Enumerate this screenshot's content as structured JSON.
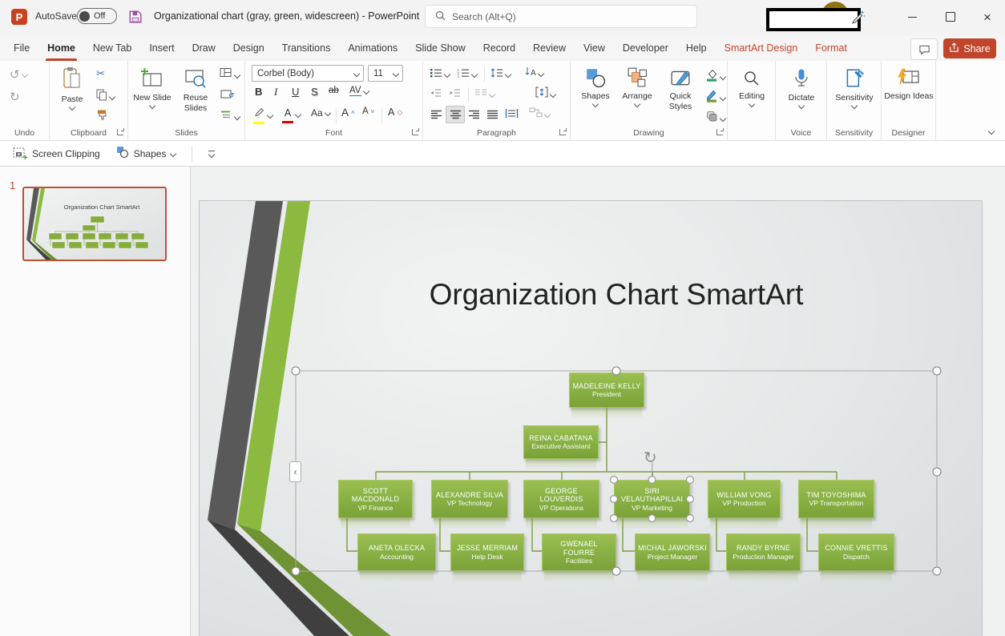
{
  "titlebar": {
    "autosave_label": "AutoSave",
    "autosave_state": "Off",
    "document_title": "Organizational chart (gray, green, widescreen)  -  PowerPoint",
    "search_placeholder": "Search (Alt+Q)"
  },
  "tabs": {
    "active_tab": "Home",
    "items": [
      {
        "label": "File",
        "contextual": false
      },
      {
        "label": "Home",
        "contextual": false
      },
      {
        "label": "New Tab",
        "contextual": false
      },
      {
        "label": "Insert",
        "contextual": false
      },
      {
        "label": "Draw",
        "contextual": false
      },
      {
        "label": "Design",
        "contextual": false
      },
      {
        "label": "Transitions",
        "contextual": false
      },
      {
        "label": "Animations",
        "contextual": false
      },
      {
        "label": "Slide Show",
        "contextual": false
      },
      {
        "label": "Record",
        "contextual": false
      },
      {
        "label": "Review",
        "contextual": false
      },
      {
        "label": "View",
        "contextual": false
      },
      {
        "label": "Developer",
        "contextual": false
      },
      {
        "label": "Help",
        "contextual": false
      },
      {
        "label": "SmartArt Design",
        "contextual": true
      },
      {
        "label": "Format",
        "contextual": true
      }
    ],
    "share_label": "Share"
  },
  "ribbon": {
    "undo": {
      "group_label": "Undo"
    },
    "clipboard": {
      "group_label": "Clipboard",
      "paste_label": "Paste"
    },
    "slides": {
      "group_label": "Slides",
      "new_slide_label": "New Slide",
      "reuse_slides_label": "Reuse Slides"
    },
    "font": {
      "group_label": "Font",
      "font_name": "Corbel (Body)",
      "font_size": "11",
      "bold": "B",
      "italic": "I",
      "underline": "U",
      "shadow": "S",
      "strikethrough": "ab",
      "char_spacing": "AV",
      "change_case": "Aa",
      "grow": "A",
      "shrink": "A",
      "clear": "A"
    },
    "paragraph": {
      "group_label": "Paragraph"
    },
    "drawing": {
      "group_label": "Drawing",
      "shapes_label": "Shapes",
      "arrange_label": "Arrange",
      "quick_styles_label": "Quick Styles"
    },
    "editing": {
      "button_label": "Editing"
    },
    "voice": {
      "group_label": "Voice",
      "dictate_label": "Dictate"
    },
    "sensitivity": {
      "group_label": "Sensitivity",
      "button_label": "Sensitivity"
    },
    "designer": {
      "group_label": "Designer",
      "design_ideas_label": "Design Ideas"
    }
  },
  "quick_toolbar": {
    "screen_clipping_label": "Screen Clipping",
    "shapes_label": "Shapes"
  },
  "slides_panel": {
    "slide_number": "1"
  },
  "slide": {
    "title": "Organization Chart SmartArt",
    "org_chart": {
      "nodes": [
        {
          "name": "MADELEINE KELLY",
          "role": "President",
          "selected": false
        },
        {
          "name": "REINA CABATANA",
          "role": "Executive Assistant",
          "selected": false
        },
        {
          "name": "SCOTT MACDONALD",
          "role": "VP Finance",
          "selected": false
        },
        {
          "name": "ALEXANDRE SILVA",
          "role": "VP Technology",
          "selected": false
        },
        {
          "name": "GEORGE LOUVERDIS",
          "role": "VP Operations",
          "selected": false
        },
        {
          "name": "SIRI VELAUTHAPILLAI",
          "role": "VP Marketing",
          "selected": true
        },
        {
          "name": "WILLIAM VONG",
          "role": "VP Production",
          "selected": false
        },
        {
          "name": "TIM TOYOSHIMA",
          "role": "VP Transportation",
          "selected": false
        },
        {
          "name": "ANETA OLECKA",
          "role": "Accounting",
          "selected": false
        },
        {
          "name": "JESSE MERRIAM",
          "role": "Help Desk",
          "selected": false
        },
        {
          "name": "GWENAEL FOURRE",
          "role": "Facilities",
          "selected": false
        },
        {
          "name": "MICHAL JAWORSKI",
          "role": "Project Manager",
          "selected": false
        },
        {
          "name": "RANDY BYRNE",
          "role": "Production Manager",
          "selected": false
        },
        {
          "name": "CONNIE VRETTIS",
          "role": "Dispatch",
          "selected": false
        }
      ]
    }
  },
  "colors": {
    "brand_red": "#C0452A",
    "box_green_top": "#94B84A",
    "box_green_bottom": "#7CA139",
    "connector_green": "#7E9C3C",
    "stripe_dark": "#595959",
    "stripe_green": "#8CBA40",
    "selection_gray": "#A8A8A8"
  }
}
